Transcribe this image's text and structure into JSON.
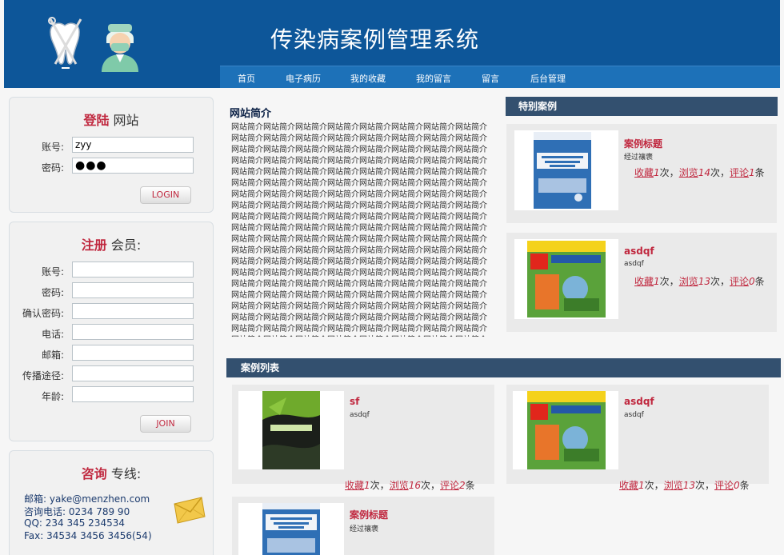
{
  "site": {
    "title": "传染病案例管理系统"
  },
  "nav": {
    "items": [
      {
        "label": "首页"
      },
      {
        "label": "电子病历"
      },
      {
        "label": "我的收藏"
      },
      {
        "label": "我的留言"
      },
      {
        "label": "留言"
      },
      {
        "label": "后台管理"
      }
    ]
  },
  "login": {
    "title_hl": "登陆",
    "title_rest": "网站",
    "account_label": "账号:",
    "account_value": "zyy",
    "password_label": "密码:",
    "password_value": "●●●",
    "button": "LOGIN"
  },
  "register": {
    "title_hl": "注册",
    "title_rest": "会员:",
    "fields": [
      {
        "label": "账号:"
      },
      {
        "label": "密码:"
      },
      {
        "label": "确认密码:"
      },
      {
        "label": "电话:"
      },
      {
        "label": "邮箱:"
      },
      {
        "label": "传播途径:"
      },
      {
        "label": "年龄:"
      }
    ],
    "button": "JOIN"
  },
  "contact": {
    "title_hl": "咨询",
    "title_rest": "专线:",
    "lines": [
      "邮箱: yake@menzhen.com",
      "咨询电话: 0234 789 90",
      "QQ: 234 345 234534",
      "Fax: 34534 3456 3456(54)"
    ]
  },
  "intro": {
    "title": "网站简介",
    "body": "网站简介网站简介网站简介网站简介网站简介网站简介网站简介网站简介网站简介网站简介网站简介网站简介网站简介网站简介网站简介网站简介网站简介网站简介网站简介网站简介网站简介网站简介网站简介网站简介网站简介网站简介网站简介网站简介网站简介网站简介网站简介网站简介网站简介网站简介网站简介网站简介网站简介网站简介网站简介网站简介网站简介网站简介网站简介网站简介网站简介网站简介网站简介网站简介网站简介网站简介网站简介网站简介网站简介网站简介网站简介网站简介网站简介网站简介网站简介网站简介网站简介网站简介网站简介网站简介网站简介网站简介网站简介网站简介网站简介网站简介网站简介网站简介网站简介网站简介网站简介网站简介网站简介网站简介网站简介网站简介网站简介网站简介网站简介网站简介网站简介网站简介网站简介网站简介网站简介网站简介网站简介网站简介网站简介网站简介网站简介网站简介网站简介网站简介网站简介网站简介网站简介网站简介网站简介网站简介网站简介网站简介网站简介网站简介网站简介网站简介网站简介网站简介网站简介网站简介网站简介网站简介网站简介网站简介网站简介网站简介网站简介网站简介网站简介网站简介网站简介网站简介网站简介网站简介网站简介网站简介网站简介网站简介网站简介网站简介网站简介网站简介网站简介网站简介网站简介网站简介网站简介网站简介网站简介网站简介网站简介网站简介网站简介网站简介网站简介网站简介网站简介网站简介网站简介网站简介网站简介网站简介网站简介网站简介网站简介网站简介网站简介网站简介网站简介网站简介网站简介网站简介网站简介网站简介网站简介网站简介网站简介网站简介网站简介网站简介网站简介网站简介网站简介网站简介网站简介网站简介网站简介网站简介网站简介网站简介网站简介网站简介网站简介网站简介网站简介网站简介网站简介网站简介网站简介网站简介网站简介网站简介网站简介网站简介网站简介网站简介网站简介网站简介网站简介网站简介网站简介网站简介网站简介网站简介网站简介网站简介网站简介网站简介网站简介网站简介网站简介网站简介网站简介网站简介网站简介网站简介网站简介网站简介网站简介网站简介网站简介网站简介网站简介网站简介网站简介网站简介网站简介网站简介网站简介网站简介网站简介网站简介网站简介网站简介网站简介网站简介网站简介网站简介网站简介网站简介网站简介网站简介网站简介网站简介网站简介网站简介网站简介网站简介网站简介网站简介网站简介网站简介"
  },
  "featured": {
    "header": "特别案例",
    "items": [
      {
        "title": "案例标题",
        "sub": "经过禳褒",
        "fav_label": "收藏",
        "fav": "1",
        "views_label": "浏览",
        "views": "14",
        "comments_label": "评论",
        "comments": "1",
        "unit_times": "次",
        "unit_items": "条",
        "sep": "，"
      },
      {
        "title": "asdqf",
        "sub": "asdqf",
        "fav_label": "收藏",
        "fav": "1",
        "views_label": "浏览",
        "views": "13",
        "comments_label": "评论",
        "comments": "0",
        "unit_times": "次",
        "unit_items": "条",
        "sep": "，"
      }
    ]
  },
  "cases": {
    "header": "案例列表",
    "items": [
      {
        "title": "sf",
        "sub": "asdqf",
        "fav_label": "收藏",
        "fav": "1",
        "views_label": "浏览",
        "views": "16",
        "comments_label": "评论",
        "comments": "2",
        "unit_times": "次",
        "unit_items": "条",
        "sep": "，"
      },
      {
        "title": "asdqf",
        "sub": "asdqf",
        "fav_label": "收藏",
        "fav": "1",
        "views_label": "浏览",
        "views": "13",
        "comments_label": "评论",
        "comments": "0",
        "unit_times": "次",
        "unit_items": "条",
        "sep": "，"
      },
      {
        "title": "案例标题",
        "sub": "经过禳褒"
      }
    ]
  },
  "colors": {
    "header_bg": "#0d5699",
    "nav_bg": "#1d71b8",
    "accent": "#c0283f",
    "section_bg": "#33506f"
  }
}
